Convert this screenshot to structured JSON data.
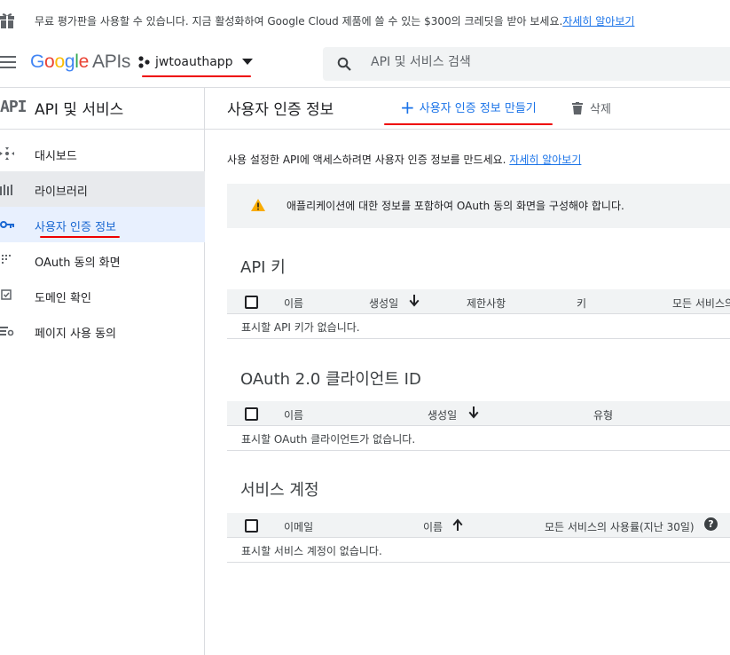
{
  "promo": {
    "text": "무료 평가판을 사용할 수 있습니다. 지금 활성화하여 Google Cloud 제품에 쓸 수 있는 $300의 크레딧을 받아 보세요.",
    "link": "자세히 알아보기"
  },
  "header": {
    "logo_letters": [
      "G",
      "o",
      "o",
      "g",
      "l",
      "e"
    ],
    "logo_suffix": "APIs",
    "project_name": "jwtoauthapp",
    "search_placeholder": "API 및 서비스 검색"
  },
  "sidebar": {
    "glyph": "API",
    "title": "API 및 서비스",
    "items": [
      {
        "label": "대시보드",
        "icon": "dashboard-icon"
      },
      {
        "label": "라이브러리",
        "icon": "library-icon"
      },
      {
        "label": "사용자 인증 정보",
        "icon": "key-icon"
      },
      {
        "label": "OAuth 동의 화면",
        "icon": "consent-grid-icon"
      },
      {
        "label": "도메인 확인",
        "icon": "checkbox-icon"
      },
      {
        "label": "페이지 사용 동의",
        "icon": "settings-list-icon"
      }
    ],
    "active_index": 2
  },
  "main": {
    "title": "사용자 인증 정보",
    "create_label": "사용자 인증 정보 만들기",
    "delete_label": "삭제",
    "intro_text": "사용 설정한 API에 액세스하려면 사용자 인증 정보를 만드세요.",
    "intro_link": "자세히 알아보기",
    "warning_text": "애플리케이션에 대한 정보를 포함하여 OAuth 동의 화면을 구성해야 합니다.",
    "colors": {
      "accent": "#1a73e8",
      "warning": "#f9ab00",
      "annotation": "#e00000"
    }
  },
  "api_keys": {
    "title": "API 키",
    "columns": [
      "이름",
      "생성일",
      "제한사항",
      "키",
      "모든 서비스의"
    ],
    "empty": "표시할 API 키가 없습니다."
  },
  "oauth": {
    "title": "OAuth 2.0 클라이언트 ID",
    "columns": [
      "이름",
      "생성일",
      "유형"
    ],
    "empty": "표시할 OAuth 클라이언트가 없습니다."
  },
  "service_accounts": {
    "title": "서비스 계정",
    "columns": [
      "이메일",
      "이름",
      "모든 서비스의 사용률(지난 30일)"
    ],
    "empty": "표시할 서비스 계정이 없습니다."
  }
}
